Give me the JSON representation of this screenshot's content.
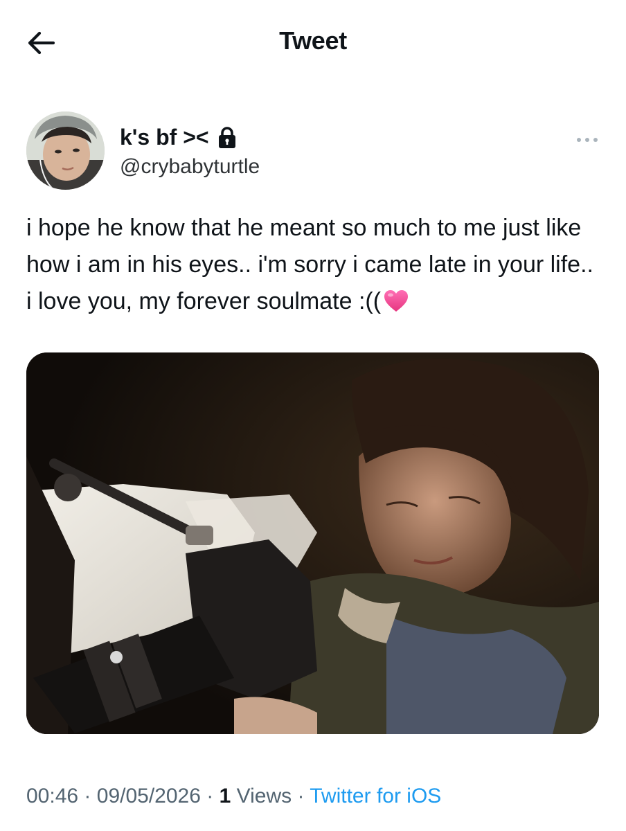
{
  "header": {
    "title": "Tweet",
    "back_icon": "arrow-left-icon"
  },
  "author": {
    "display_name": "k's bf ><",
    "handle": "@crybabyturtle",
    "protected_icon": "lock-icon",
    "more_icon": "more-horizontal-icon"
  },
  "tweet": {
    "text": "i hope he know that he meant so much to me just like how i am in his eyes.. i'm sorry i came late in your life.. i love you, my forever soulmate :((",
    "emoji": "pink-heart"
  },
  "meta": {
    "time": "00:46",
    "date": "09/05/2026",
    "views_count": "1",
    "views_label": "Views",
    "source": "Twitter for iOS",
    "separator": "·"
  },
  "colors": {
    "text_primary": "#0f1419",
    "text_secondary": "#536471",
    "link": "#1d9bf0",
    "heart": "#f4479b"
  }
}
